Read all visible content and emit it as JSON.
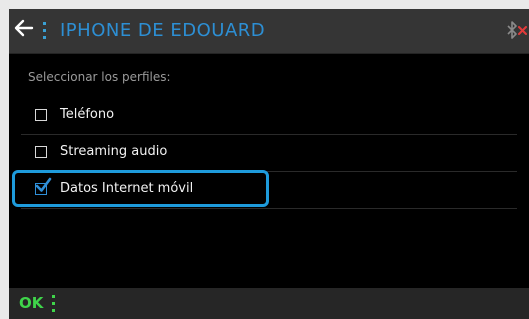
{
  "header": {
    "back_icon": "arrow-left-icon",
    "title": "IPHONE DE EDOUARD",
    "status_icon": "bluetooth-disconnected-icon",
    "accent_color": "#2d8fd4"
  },
  "profiles": {
    "section_label": "Seleccionar los perfiles:",
    "items": [
      {
        "label": "Teléfono",
        "checked": false
      },
      {
        "label": "Streaming audio",
        "checked": false
      },
      {
        "label": "Datos Internet móvil",
        "checked": true
      }
    ]
  },
  "footer": {
    "ok_label": "OK",
    "ok_color": "#3fd44a"
  }
}
